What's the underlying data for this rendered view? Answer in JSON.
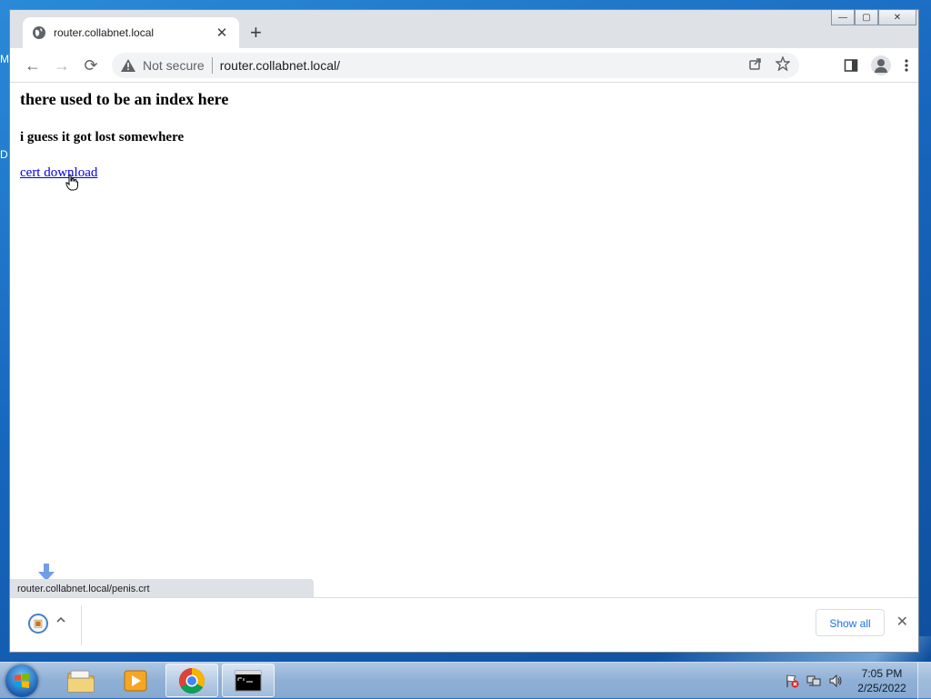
{
  "desktop": {
    "edge_letters": [
      "M",
      "D"
    ]
  },
  "browser": {
    "tab": {
      "title": "router.collabnet.local",
      "close": "✕"
    },
    "new_tab": "+",
    "window_controls": {
      "minimize": "—",
      "maximize": "▢",
      "close": "✕"
    },
    "nav": {
      "back": "←",
      "forward": "→",
      "reload": "⟳"
    },
    "omnibox": {
      "security_label": "Not secure",
      "url": "router.collabnet.local/"
    },
    "page": {
      "heading": "there used to be an index here",
      "subheading": "i guess it got lost somewhere",
      "link_text": "cert download"
    },
    "status_bar_url": "router.collabnet.local/penis.crt",
    "download_shelf": {
      "show_all_label": "Show all",
      "close": "✕"
    }
  },
  "taskbar": {
    "apps": [
      "file-explorer",
      "media-player",
      "chrome",
      "command-prompt"
    ],
    "clock": {
      "time": "7:05 PM",
      "date": "2/25/2022"
    }
  },
  "colors": {
    "link": "#0000ee",
    "accent_blue": "#1a73e8",
    "desktop_blue": "#1766bd"
  }
}
